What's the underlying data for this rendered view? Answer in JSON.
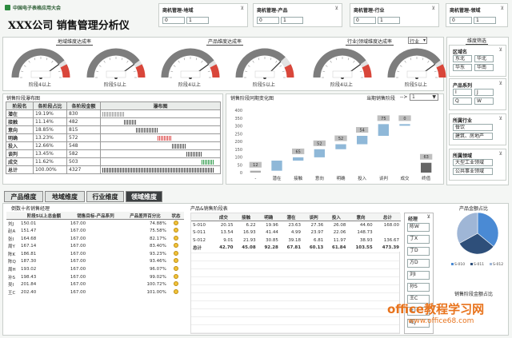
{
  "header": {
    "org": "中国电子表格应用大会",
    "title": "XXX公司 销售管理分析仪"
  },
  "top_slicers": [
    {
      "title": "商机管理-地域",
      "values": [
        "0",
        "1"
      ]
    },
    {
      "title": "商机管理-产品",
      "values": [
        "0",
        "1"
      ]
    },
    {
      "title": "商机管理-行业",
      "values": [
        "0",
        "1"
      ]
    },
    {
      "title": "商机管理-领域",
      "values": [
        "0",
        "1"
      ]
    }
  ],
  "gauges": {
    "panels": [
      {
        "title": "地域维度达成率",
        "items": [
          {
            "label": "阶段4以上",
            "value": 0.8
          },
          {
            "label": "阶段5以上",
            "value": 0.8
          }
        ]
      },
      {
        "title": "产品维度达成率",
        "items": [
          {
            "label": "阶段4以上",
            "value": 0.8
          },
          {
            "label": "阶段5以上",
            "value": 0.75
          }
        ]
      },
      {
        "title": "行业|领域维度达成率",
        "dropdown": "行业",
        "items": [
          {
            "label": "阶段4以上",
            "value": 0.8
          },
          {
            "label": "阶段5以上",
            "value": 0.8
          }
        ]
      }
    ]
  },
  "filters": {
    "title": "维度筛选",
    "region": {
      "label": "区域名",
      "items": [
        "东北",
        "华北",
        "华东",
        "华南"
      ]
    },
    "product": {
      "label": "产品系列",
      "items": [
        "I",
        "J",
        "Q",
        "W"
      ]
    },
    "industry": {
      "label": "所属行业",
      "items": [
        "餐饮",
        "建筑、房地产"
      ]
    },
    "domain": {
      "label": "所属领域",
      "items": [
        "大型工业领域",
        "公共事业领域"
      ]
    }
  },
  "stage_table": {
    "title": "销售阶段瀑布图",
    "headers": [
      "阶段名",
      "各阶段占比",
      "各阶段金额",
      "瀑布图"
    ],
    "rows": [
      [
        "潜在",
        "19.19%",
        "830"
      ],
      [
        "接触",
        "11.14%",
        "482"
      ],
      [
        "意向",
        "18.85%",
        "815"
      ],
      [
        "明确",
        "13.23%",
        "572"
      ],
      [
        "投入",
        "12.66%",
        "548"
      ],
      [
        "谈判",
        "13.45%",
        "582"
      ],
      [
        "成交",
        "11.62%",
        "503"
      ],
      [
        "总计",
        "100.00%",
        "4327"
      ]
    ]
  },
  "waterfall": {
    "title": "销售阶段同期变化图",
    "selector_label": "当期销售阶段",
    "selector_arrow": "-->",
    "selector_value": "1"
  },
  "chart_data": {
    "type": "bar",
    "categories": [
      "-",
      "潜在",
      "接触",
      "意向",
      "明确",
      "投入",
      "谈判",
      "成交",
      "终值"
    ],
    "series": [
      {
        "values": [
          12,
          65,
          21,
          52,
          32,
          54,
          75,
          0,
          63
        ]
      }
    ],
    "labels": [
      "12",
      "",
      "65",
      "52",
      "52",
      "54",
      "75",
      "0",
      "63"
    ],
    "ylim": [
      0,
      400
    ],
    "yticks": [
      "400",
      "350",
      "300",
      "250",
      "200",
      "150",
      "100",
      "50",
      "0"
    ]
  },
  "tabs": [
    "产品维度",
    "地域维度",
    "行业维度",
    "领域维度"
  ],
  "active_tab": 3,
  "bottom_left": {
    "title": "倒数十名销售经理",
    "headers": [
      "阶段5以上总金额",
      "销售目标-产品系列",
      "产品差异百分比",
      "状态"
    ],
    "rows": [
      [
        "刘J",
        "150.01",
        "167.00",
        "74.88%"
      ],
      [
        "赵A",
        "151.47",
        "167.00",
        "75.58%"
      ],
      [
        "张I",
        "164.68",
        "167.00",
        "82.17%"
      ],
      [
        "周Y",
        "167.14",
        "167.00",
        "83.40%"
      ],
      [
        "陈K",
        "186.81",
        "167.00",
        "93.23%"
      ],
      [
        "陈Q",
        "187.30",
        "167.00",
        "93.46%"
      ],
      [
        "周H",
        "193.02",
        "167.00",
        "96.07%"
      ],
      [
        "孙S",
        "198.43",
        "167.00",
        "99.02%"
      ],
      [
        "吴I",
        "201.84",
        "167.00",
        "100.72%"
      ],
      [
        "王C",
        "202.40",
        "167.00",
        "101.00%"
      ]
    ]
  },
  "bottom_mid": {
    "title": "产品&销售阶段表",
    "headers": [
      "",
      "成交",
      "接触",
      "明确",
      "潜在",
      "谈判",
      "投入",
      "意向",
      "总计"
    ],
    "rows": [
      [
        "S-010",
        "20.15",
        "6.22",
        "19.96",
        "23.63",
        "27.36",
        "26.08",
        "44.60",
        "168.00"
      ],
      [
        "S-011",
        "13.54",
        "16.93",
        "41.44",
        "4.99",
        "23.97",
        "22.06",
        "148.73"
      ],
      [
        "S-012",
        "9.01",
        "21.93",
        "30.85",
        "39.18",
        "6.81",
        "11.97",
        "38.93",
        "136.67"
      ],
      [
        "总计",
        "42.70",
        "45.08",
        "92.28",
        "67.81",
        "60.13",
        "61.84",
        "103.55",
        "473.39"
      ]
    ],
    "manager_header": "经理",
    "managers": [
      "陈W",
      "丁X",
      "丁D",
      "方D",
      "刘I",
      "孙S",
      "王C",
      "王I",
      "旺J"
    ]
  },
  "pie": {
    "title": "产品金额占比",
    "legend": [
      "S-010",
      "S-011",
      "S-012"
    ],
    "values": [
      0.36,
      0.31,
      0.33
    ],
    "colors": [
      "#4a8ad4",
      "#2e4f7a",
      "#9fb6d6"
    ]
  },
  "pie2": {
    "title": "销售阶段金额占比"
  },
  "watermark": {
    "text": "office教程学习网",
    "url": "www.office68.com"
  }
}
